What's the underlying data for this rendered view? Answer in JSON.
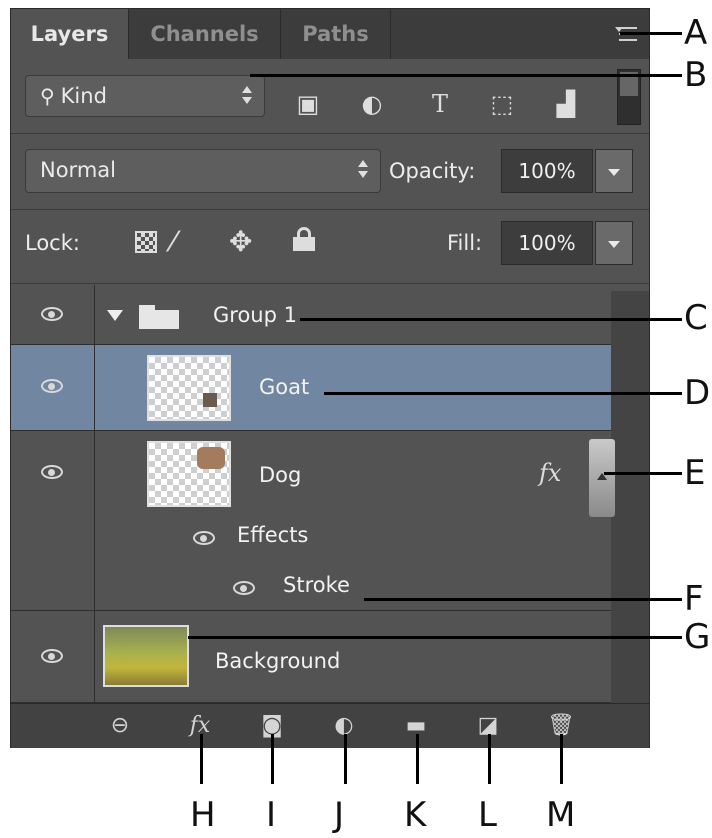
{
  "tabs": [
    "Layers",
    "Channels",
    "Paths"
  ],
  "filter": {
    "label": "Kind",
    "icons": [
      "image-filter-icon",
      "adjustment-filter-icon",
      "type-filter-icon",
      "shape-filter-icon",
      "smart-object-filter-icon"
    ]
  },
  "blend": {
    "mode": "Normal",
    "opacity_label": "Opacity:",
    "opacity_value": "100%"
  },
  "lock": {
    "label": "Lock:",
    "fill_label": "Fill:",
    "fill_value": "100%"
  },
  "layers": {
    "group": "Group 1",
    "goat": "Goat",
    "dog": "Dog",
    "fx": "fx",
    "effects": "Effects",
    "stroke": "Stroke",
    "background": "Background"
  },
  "bottom_icons": [
    "link-icon",
    "fx-icon",
    "mask-icon",
    "adjustment-icon",
    "folder-icon",
    "new-layer-icon",
    "trash-icon"
  ],
  "callouts": [
    "A",
    "B",
    "C",
    "D",
    "E",
    "F",
    "G",
    "H",
    "I",
    "J",
    "K",
    "L",
    "M"
  ]
}
